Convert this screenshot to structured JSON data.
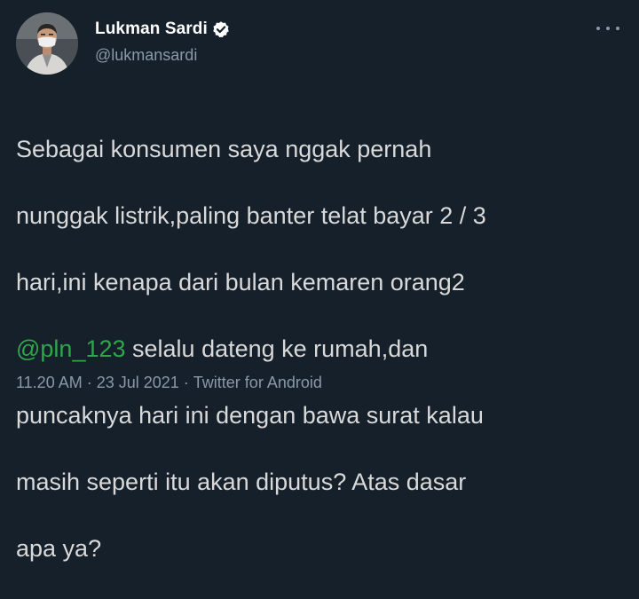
{
  "user": {
    "display_name": "Lukman Sardi",
    "handle": "@lukmansardi",
    "verified_icon": "verified-badge-icon",
    "avatar_icon": "avatar-photo"
  },
  "menu": {
    "more_icon": "more-options-icon",
    "glyph": "···"
  },
  "tweet": {
    "line1": "Sebagai konsumen saya nggak pernah",
    "line2": "nunggak listrik,paling banter telat bayar 2 / 3",
    "line3": "hari,ini kenapa dari bulan kemaren orang2",
    "mention": "@pln_123",
    "line4_rest": " selalu dateng ke rumah,dan",
    "line5": "puncaknya hari ini dengan bawa surat kalau",
    "line6": "masih seperti itu akan diputus? Atas dasar",
    "line7": "apa ya?"
  },
  "meta": {
    "time": "11.20 AM",
    "separator1": "·",
    "date": "23 Jul 2021",
    "separator2": "·",
    "source": "Twitter for Android"
  },
  "colors": {
    "background": "#15202b",
    "text": "#d9d9d9",
    "secondary": "#8b98a5",
    "mention": "#2fa64a",
    "verified": "#ffffff"
  }
}
